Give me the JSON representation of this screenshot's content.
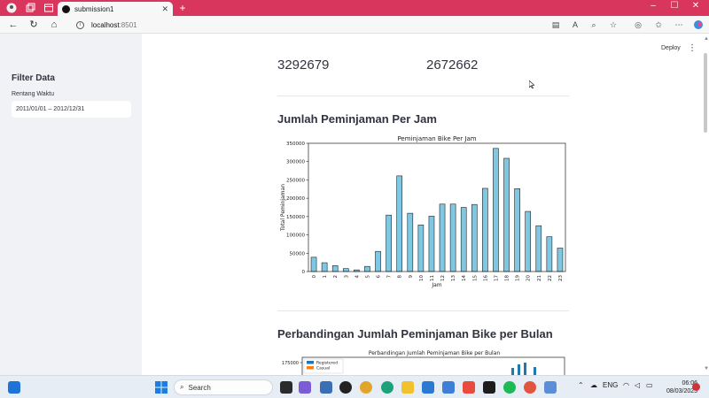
{
  "browser": {
    "tab_title": "submission1",
    "url_host": "localhost",
    "url_port": ":8501"
  },
  "sidebar": {
    "title": "Filter Data",
    "date_label": "Rentang Waktu",
    "date_value": "2011/01/01 – 2012/12/31"
  },
  "header": {
    "deploy_label": "Deploy"
  },
  "metrics": {
    "value_1": "3292679",
    "value_2": "2672662"
  },
  "section_1": {
    "title": "Jumlah Peminjaman Per Jam"
  },
  "section_2": {
    "title": "Perbandingan Jumlah Peminjaman Bike per Bulan"
  },
  "chart_data": [
    {
      "type": "bar",
      "title": "Peminjaman Bike Per Jam",
      "xlabel": "Jam",
      "ylabel": "Total Peminjaman",
      "ylim": [
        0,
        350000
      ],
      "yticks": [
        0,
        50000,
        100000,
        150000,
        200000,
        250000,
        300000,
        350000
      ],
      "categories": [
        "0",
        "1",
        "2",
        "3",
        "4",
        "5",
        "6",
        "7",
        "8",
        "9",
        "10",
        "11",
        "12",
        "13",
        "14",
        "15",
        "16",
        "17",
        "18",
        "19",
        "20",
        "21",
        "22",
        "23"
      ],
      "values": [
        39000,
        24000,
        16000,
        8000,
        4500,
        14000,
        55000,
        154000,
        261000,
        159000,
        127000,
        151000,
        184000,
        184000,
        175000,
        183000,
        227000,
        336000,
        309000,
        226000,
        164000,
        125000,
        95000,
        64000
      ],
      "bar_color": "#7ec8e3",
      "grid": false
    },
    {
      "type": "bar",
      "title": "Perbandingan Jumlah Peminjaman Bike per Bulan",
      "ytick_visible": "175000",
      "legend": [
        "Registered",
        "Casual"
      ],
      "legend_colors": [
        "#1f77b4",
        "#ff7f0e"
      ],
      "legend_position": "top-left"
    }
  ],
  "taskbar": {
    "search_label": "Search",
    "language": "ENG",
    "time": "06:06",
    "date": "08/03/2025"
  }
}
